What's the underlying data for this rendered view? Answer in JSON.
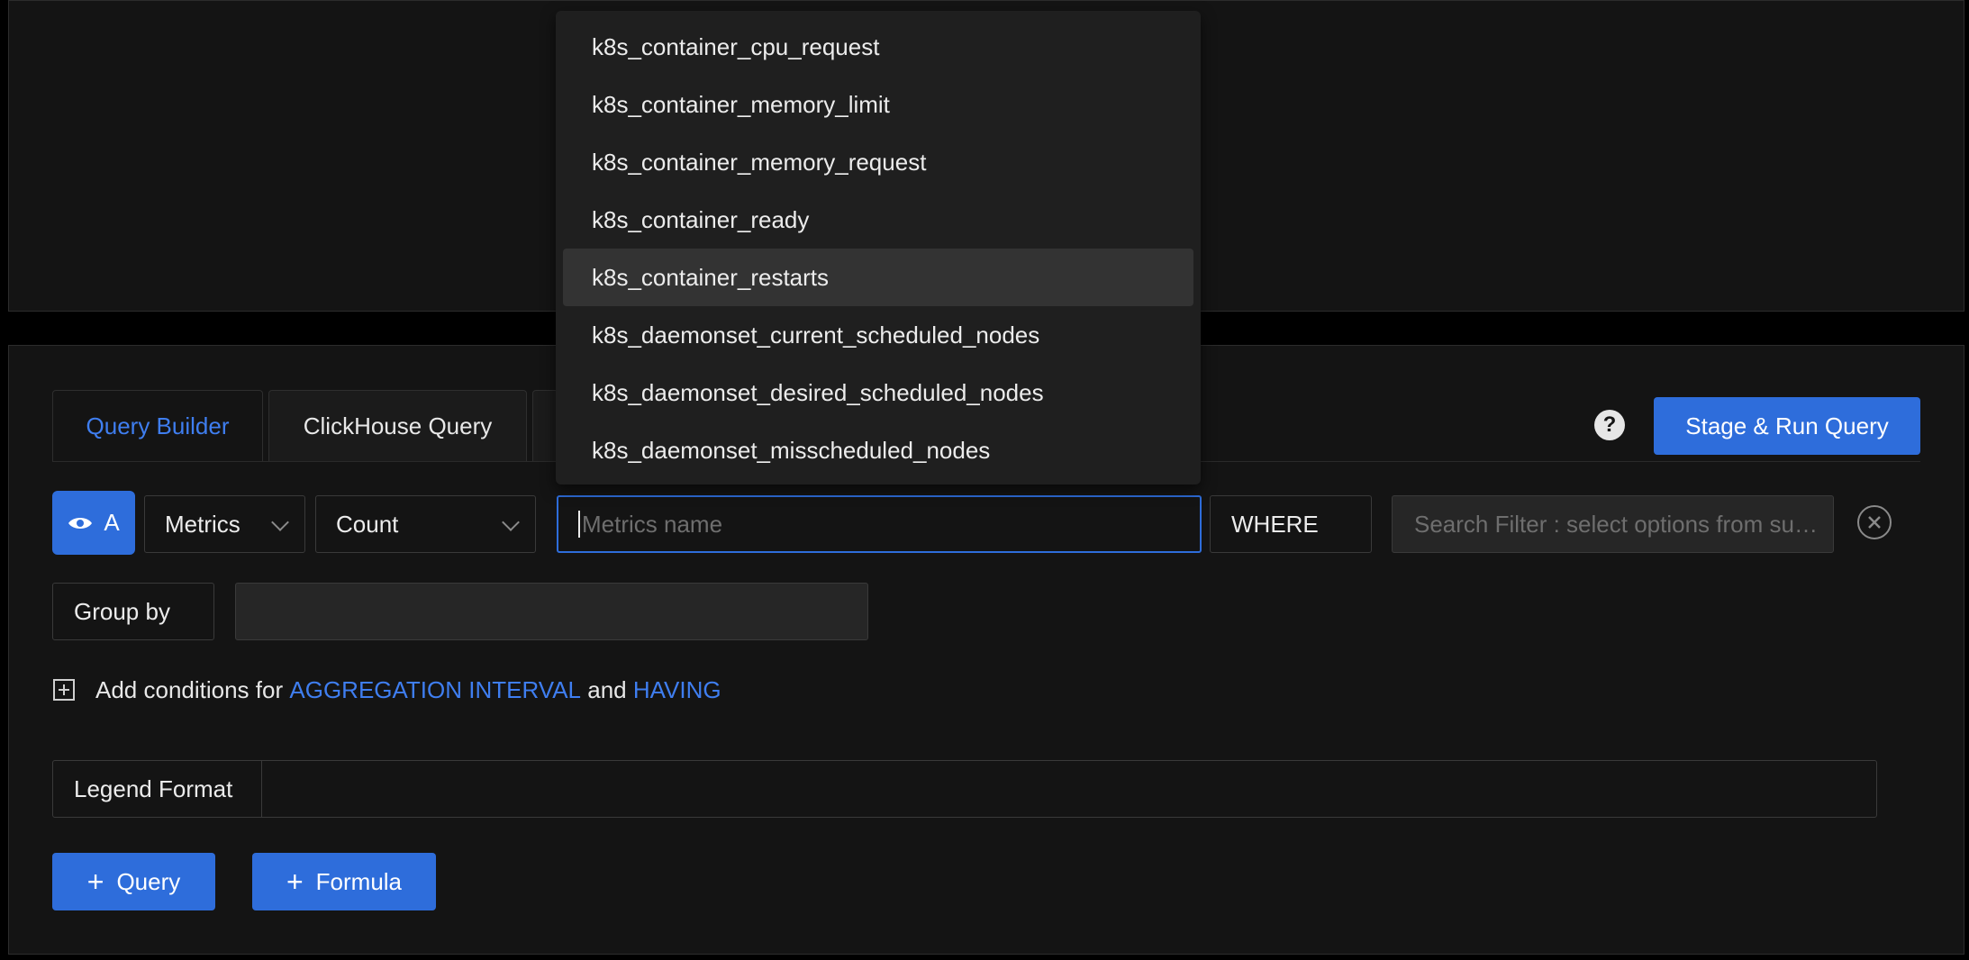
{
  "tabs": [
    {
      "label": "Query Builder",
      "active": true
    },
    {
      "label": "ClickHouse Query",
      "active": false
    }
  ],
  "header": {
    "run_label": "Stage & Run Query",
    "help_glyph": "?"
  },
  "query": {
    "letter": "A",
    "data_source": "Metrics",
    "aggregation": "Count",
    "metric_placeholder": "Metrics name",
    "where_label": "WHERE",
    "filter_placeholder": "Search Filter : select options from suggested values, for IN/NOT IN operators - press \"Enter\" after selecting options",
    "group_by_label": "Group by",
    "conditions_prefix": "Add conditions for",
    "conditions_link1": "AGGREGATION INTERVAL",
    "conditions_and": "and",
    "conditions_link2": "HAVING",
    "legend_label": "Legend Format"
  },
  "footer": {
    "add_query_label": "Query",
    "add_formula_label": "Formula"
  },
  "dropdown": {
    "options": [
      "k8s_container_cpu_request",
      "k8s_container_memory_limit",
      "k8s_container_memory_request",
      "k8s_container_ready",
      "k8s_container_restarts",
      "k8s_daemonset_current_scheduled_nodes",
      "k8s_daemonset_desired_scheduled_nodes",
      "k8s_daemonset_misscheduled_nodes"
    ],
    "hovered_index": 4
  },
  "colors": {
    "accent": "#2e6ddb",
    "link": "#3f7ef0",
    "background": "#141414"
  }
}
